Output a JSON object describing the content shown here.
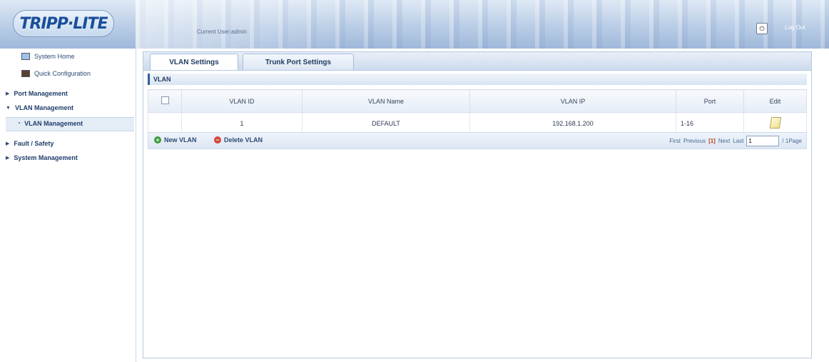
{
  "header": {
    "logo": "TRIPP·LITE",
    "current_user": "Current User:admin",
    "logout_label": "Log Out"
  },
  "sidebar": {
    "system_home": "System Home",
    "quick_config": "Quick Configuration",
    "port_management": "Port Management",
    "vlan_management": "VLAN Management",
    "vlan_management_sub": "VLAN Management",
    "fault_safety": "Fault / Safety",
    "system_management": "System Management"
  },
  "tabs": [
    {
      "label": "VLAN Settings"
    },
    {
      "label": "Trunk Port Settings"
    }
  ],
  "section_title": "VLAN",
  "table": {
    "headers": [
      "",
      "VLAN ID",
      "VLAN Name",
      "VLAN IP",
      "Port",
      "Edit"
    ],
    "rows": [
      {
        "vlan_id": "1",
        "vlan_name": "DEFAULT",
        "vlan_ip": "192.168.1.200",
        "port": "1-16"
      }
    ]
  },
  "toolbar": {
    "new_vlan": "New VLAN",
    "delete_vlan": "Delete VLAN"
  },
  "pager": {
    "first": "First",
    "previous": "Previous",
    "current": "[1]",
    "next": "Next",
    "last": "Last",
    "page_input": "1",
    "total": "/ 1Page"
  }
}
